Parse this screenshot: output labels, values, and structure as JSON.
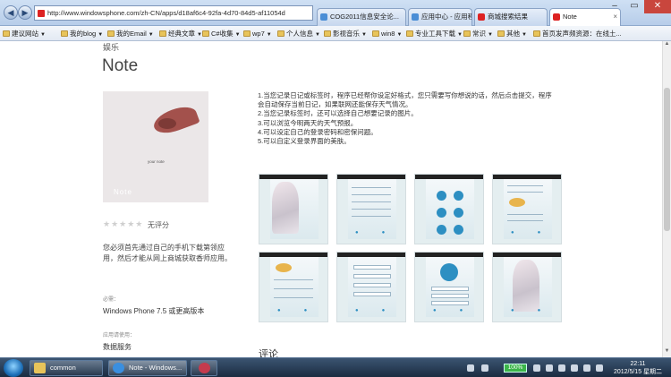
{
  "browser": {
    "address": "http://www.windowsphone.com/zh-CN/apps/d18af6c4-92fa-4d70-84d5-af11054d",
    "tabs": [
      {
        "title": "COG2011信息安全论..."
      },
      {
        "title": "应用中心 - 应用程序..."
      },
      {
        "title": "商城搜索结果"
      },
      {
        "title": "Note"
      }
    ],
    "bookmarks": [
      {
        "label": "建议网站"
      },
      {
        "label": "我的blog"
      },
      {
        "label": "我的Email"
      },
      {
        "label": "经典文章"
      },
      {
        "label": "C#收集"
      },
      {
        "label": "wp7"
      },
      {
        "label": "个人信息"
      },
      {
        "label": "影视音乐"
      },
      {
        "label": "win8"
      },
      {
        "label": "专业工具下载"
      },
      {
        "label": "常识"
      },
      {
        "label": "其他"
      },
      {
        "label": "首页发声频资源：在线土..."
      }
    ]
  },
  "app": {
    "category": "娱乐",
    "title": "Note",
    "icon_caption": "Note",
    "icon_small_text": "your note",
    "rating_text": "无评分",
    "download_note": "您必须首先通过自己的手机下载第领应用，然后才能从网上商城获取香师应用。",
    "requires_label": "必需：",
    "requires_value": "Windows Phone 7.5 或更高版本",
    "permissions_label": "应用请使用：",
    "permissions_value": "数据服务",
    "description": [
      "1.当您记录日记或标签时，程序已经帮你设定好格式，您只需要写你想说的话，然后点击提交，程序",
      "会自动保存当前日记，如果联网还能保存天气情况。",
      " 2.当您记录标签时，还可以选择自己想要记录的图片。",
      "3.可以浏览今明两天的天气预报。",
      " 4.可以设定自己的登录密码和密保问题。",
      " 5.可以自定义登录界面的美肤。"
    ],
    "comments_heading": "评论"
  },
  "taskbar": {
    "items": [
      {
        "label": "common"
      },
      {
        "label": "Note - Windows..."
      },
      {
        "label": ""
      }
    ],
    "battery": "100%",
    "time": "22:11",
    "date": "2012/5/15 星期二"
  },
  "colors": {
    "accent": "#2d8fc2",
    "taskbar": "#1b2c41",
    "chrome": "#b7cde9"
  }
}
